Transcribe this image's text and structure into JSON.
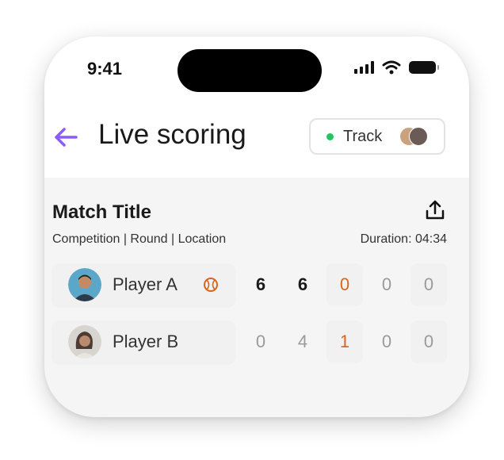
{
  "status_bar": {
    "time": "9:41"
  },
  "header": {
    "title": "Live scoring",
    "track_label": "Track"
  },
  "match": {
    "title": "Match Title",
    "meta": "Competition | Round | Location",
    "duration": "Duration: 04:34"
  },
  "players": [
    {
      "name": "Player A",
      "serving": true,
      "scores": [
        "6",
        "6",
        "0",
        "0",
        "0"
      ]
    },
    {
      "name": "Player B",
      "serving": false,
      "scores": [
        "0",
        "4",
        "1",
        "0",
        "0"
      ]
    }
  ],
  "colors": {
    "accent": "#8b5cf6",
    "live": "#22c55e",
    "current_game": "#d9641c"
  }
}
